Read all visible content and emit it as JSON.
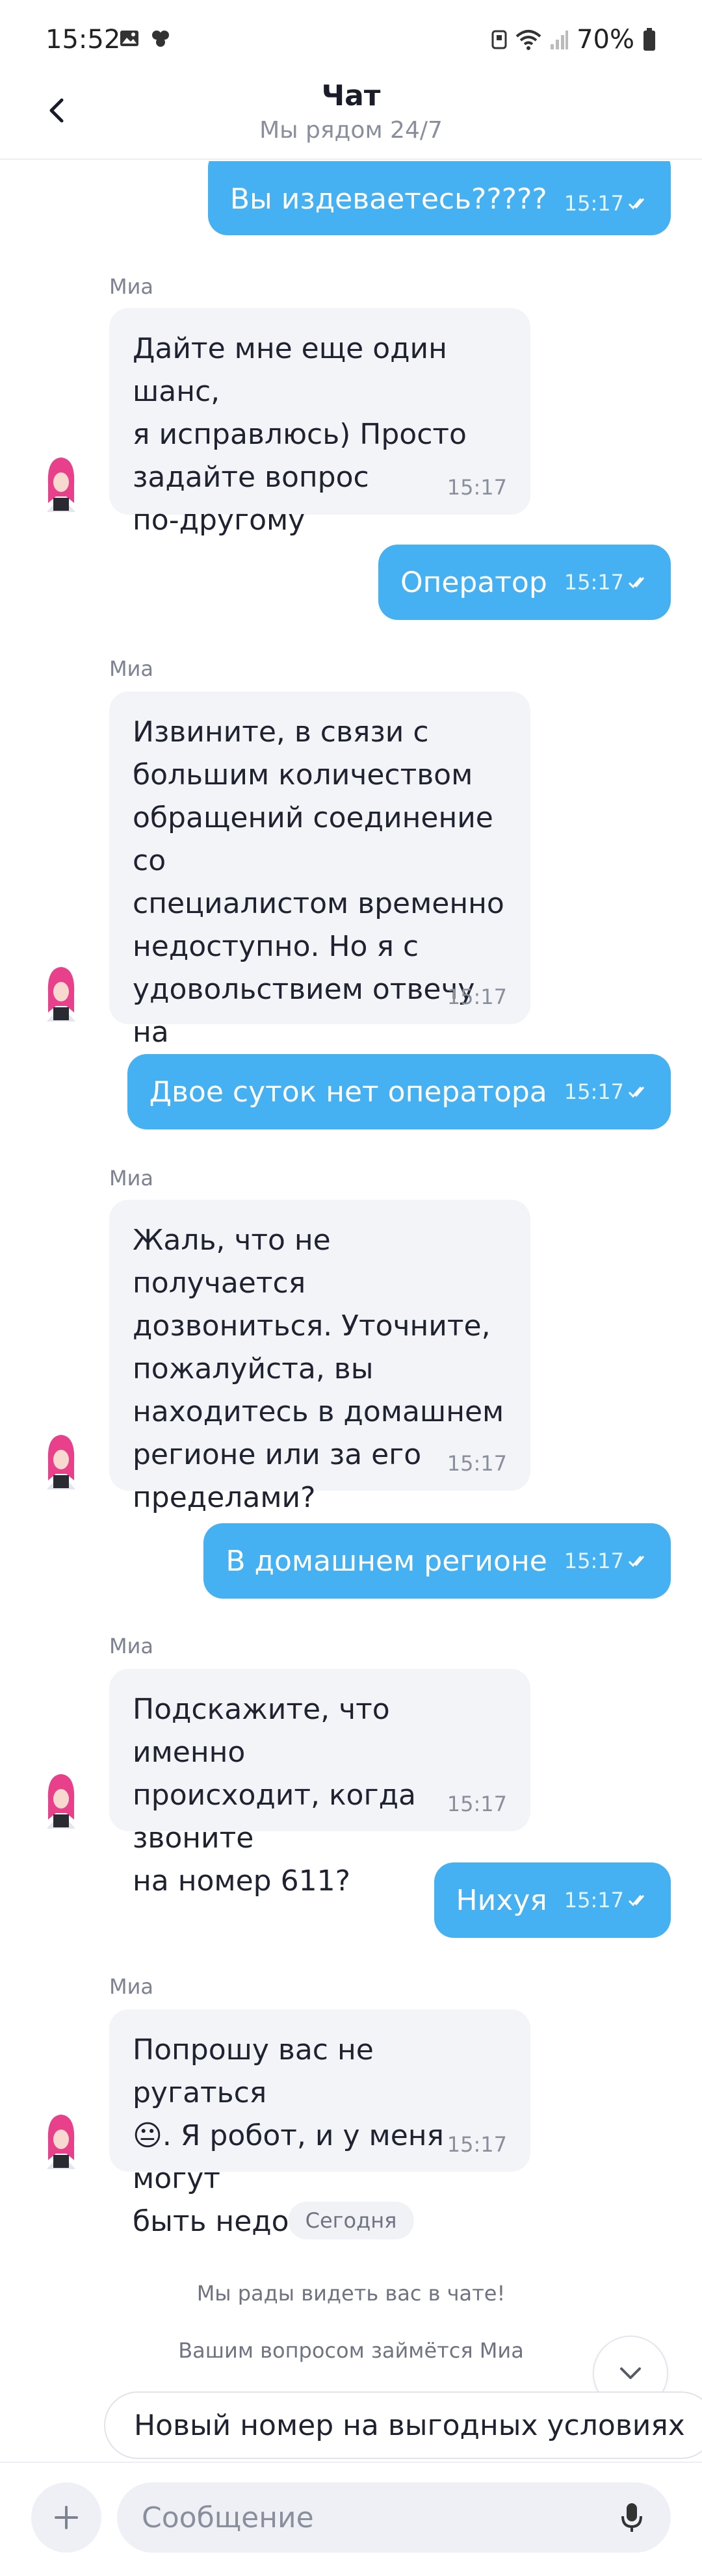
{
  "status_bar": {
    "time": "15:52",
    "battery": "70%"
  },
  "header": {
    "title": "Чат",
    "subtitle": "Мы рядом 24/7"
  },
  "messages": [
    {
      "dir": "out",
      "text": "Вы издеваетесь?????",
      "time": "15:17"
    },
    {
      "dir": "in",
      "sender": "Миа",
      "text": "Дайте мне еще один шанс,\nя исправлюсь) Просто\nзадайте вопрос\nпо-другому",
      "time": "15:17"
    },
    {
      "dir": "out",
      "text": "Оператор",
      "time": "15:17"
    },
    {
      "dir": "in",
      "sender": "Миа",
      "text": "Извините, в связи с\nбольшим количеством\nобращений соединение со\nспециалистом временно\nнедоступно. Но я с\nудовольствием отвечу на\nваши вопросы",
      "time": "15:17"
    },
    {
      "dir": "out",
      "text": "Двое суток нет оператора",
      "time": "15:17"
    },
    {
      "dir": "in",
      "sender": "Миа",
      "text": "Жаль, что не получается\nдозвониться. Уточните,\nпожалуйста, вы\nнаходитесь в домашнем\nрегионе или за его\nпределами?",
      "time": "15:17"
    },
    {
      "dir": "out",
      "text": "В домашнем регионе",
      "time": "15:17"
    },
    {
      "dir": "in",
      "sender": "Миа",
      "text": "Подскажите, что именно\nпроисходит, когда звоните\nна номер 611?",
      "time": "15:17"
    },
    {
      "dir": "out",
      "text": "Нихуя",
      "time": "15:17"
    },
    {
      "dir": "in",
      "sender": "Миа",
      "text": "Попрошу вас не ругаться\n😐. Я робот, и у меня могут\nбыть недостатки",
      "time": "15:17"
    }
  ],
  "day_divider": "Сегодня",
  "system_messages": [
    "Мы рады видеть вас в чате!",
    "Вашим вопросом займётся Миа"
  ],
  "quick_reply": "Новый номер на выгодных условиях",
  "composer": {
    "placeholder": "Сообщение"
  },
  "colors": {
    "accent": "#45b0f2",
    "incoming_bubble": "#f2f4f8",
    "avatar_hair": "#e8408a"
  },
  "icons": {
    "back": "chevron-left-icon",
    "scroll_down": "chevron-down-icon",
    "attach": "plus-icon",
    "mic": "microphone-icon",
    "read_status": "double-check-icon"
  }
}
